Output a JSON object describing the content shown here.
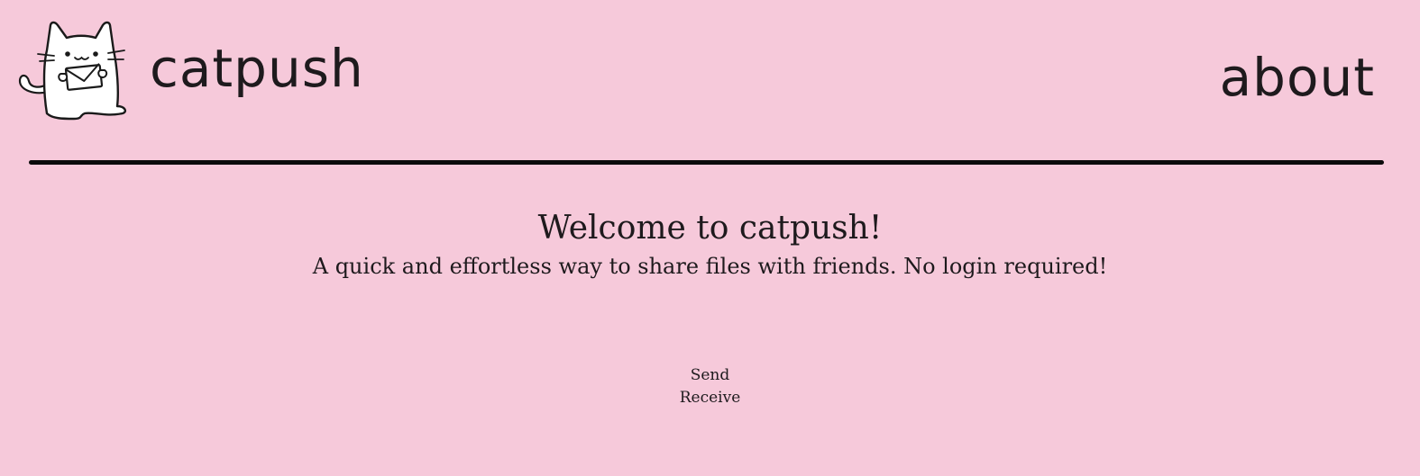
{
  "header": {
    "logo_icon": "cat-holding-envelope-icon",
    "brand_name": "catpush",
    "about_label": "about"
  },
  "hero": {
    "title": "Welcome to catpush!",
    "subtitle": "A quick and effortless way to share files with friends. No login required!"
  },
  "actions": {
    "send_label": "Send",
    "receive_label": "Receive"
  },
  "colors": {
    "background": "#f6c9da",
    "text": "#1e1a1d",
    "divider": "#0b0b0b"
  }
}
